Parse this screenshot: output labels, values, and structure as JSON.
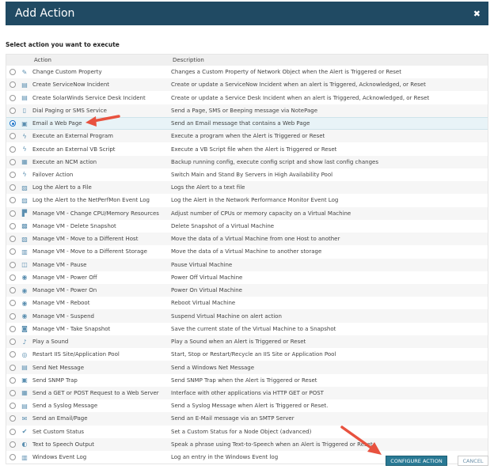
{
  "dialog": {
    "title": "Add Action",
    "close_icon": "close-icon"
  },
  "prompt": "Select action you want to execute",
  "table": {
    "headers": {
      "action": "Action",
      "description": "Description"
    },
    "selected_index": 4,
    "rows": [
      {
        "icon": "pencil",
        "action": "Change Custom Property",
        "description": "Changes a Custom Property of Network Object when the Alert is Triggered or Reset"
      },
      {
        "icon": "ticket",
        "action": "Create ServiceNow Incident",
        "description": "Create or update a ServiceNow Incident when an alert is Triggered, Acknowledged, or Reset"
      },
      {
        "icon": "ticket",
        "action": "Create SolarWinds Service Desk Incident",
        "description": "Create or update a Service Desk Incident when an alert is Triggered, Acknowledged, or Reset"
      },
      {
        "icon": "pager",
        "action": "Dial Paging or SMS Service",
        "description": "Send a Page, SMS or Beeping message via NotePage"
      },
      {
        "icon": "web-page",
        "action": "Email a Web Page",
        "description": "Send an Email message that contains a Web Page"
      },
      {
        "icon": "lightning",
        "action": "Execute an External Program",
        "description": "Execute a program when the Alert is Triggered or Reset"
      },
      {
        "icon": "lightning",
        "action": "Execute an External VB Script",
        "description": "Execute a VB Script file when the Alert is Triggered or Reset"
      },
      {
        "icon": "ncm",
        "action": "Execute an NCM action",
        "description": "Backup running config, execute config script and show last config changes"
      },
      {
        "icon": "lightning",
        "action": "Failover Action",
        "description": "Switch Main and Stand By Servers in High Availability Pool"
      },
      {
        "icon": "log",
        "action": "Log the Alert to a File",
        "description": "Logs the Alert to a text file"
      },
      {
        "icon": "log",
        "action": "Log the Alert to the NetPerfMon Event Log",
        "description": "Log the Alert in the Network Performance Monitor Event Log"
      },
      {
        "icon": "vm-resources",
        "action": "Manage VM - Change CPU/Memory Resources",
        "description": "Adjust number of CPUs or memory capacity on a Virtual Machine"
      },
      {
        "icon": "vm-snapshot-delete",
        "action": "Manage VM - Delete Snapshot",
        "description": "Delete Snapshot of a Virtual Machine"
      },
      {
        "icon": "vm-move-host",
        "action": "Manage VM - Move to a Different Host",
        "description": "Move the data of a Virtual Machine from one Host to another"
      },
      {
        "icon": "vm-move-storage",
        "action": "Manage VM - Move to a Different Storage",
        "description": "Move the data of a Virtual Machine to another storage"
      },
      {
        "icon": "pause",
        "action": "Manage VM - Pause",
        "description": "Pause Virtual Machine"
      },
      {
        "icon": "power",
        "action": "Manage VM - Power Off",
        "description": "Power Off Virtual Machine"
      },
      {
        "icon": "power",
        "action": "Manage VM - Power On",
        "description": "Power On Virtual Machine"
      },
      {
        "icon": "power",
        "action": "Manage VM - Reboot",
        "description": "Reboot Virtual Machine"
      },
      {
        "icon": "power",
        "action": "Manage VM - Suspend",
        "description": "Suspend Virtual Machine on alert action"
      },
      {
        "icon": "camera",
        "action": "Manage VM - Take Snapshot",
        "description": "Save the current state of the Virtual Machine to a Snapshot"
      },
      {
        "icon": "sound",
        "action": "Play a Sound",
        "description": "Play a Sound when an Alert is Triggered or Reset"
      },
      {
        "icon": "iis",
        "action": "Restart IIS Site/Application Pool",
        "description": "Start, Stop or Restart/Recycle an IIS Site or Application Pool"
      },
      {
        "icon": "message",
        "action": "Send Net Message",
        "description": "Send a Windows Net Message"
      },
      {
        "icon": "trap",
        "action": "Send SNMP Trap",
        "description": "Send SNMP Trap when the Alert is Triggered or Reset"
      },
      {
        "icon": "web-request",
        "action": "Send a GET or POST Request to a Web Server",
        "description": "Interface with other applications via HTTP GET or POST"
      },
      {
        "icon": "syslog",
        "action": "Send a Syslog Message",
        "description": "Send a Syslog Message when Alert is Triggered or Reset."
      },
      {
        "icon": "email",
        "action": "Send an Email/Page",
        "description": "Send an E-Mail message via an SMTP Server"
      },
      {
        "icon": "check",
        "action": "Set Custom Status",
        "description": "Set a Custom Status for a Node Object (advanced)"
      },
      {
        "icon": "speech",
        "action": "Text to Speech Output",
        "description": "Speak a phrase using Text-to-Speech when an Alert is Triggered or Reset"
      },
      {
        "icon": "event-log",
        "action": "Windows Event Log",
        "description": "Log an entry in the Windows Event log"
      }
    ]
  },
  "buttons": {
    "configure": "CONFIGURE ACTION",
    "cancel": "CANCEL"
  },
  "colors": {
    "titlebar": "#204a63",
    "primary_button": "#297994",
    "annotation_arrow": "#e8523f"
  }
}
